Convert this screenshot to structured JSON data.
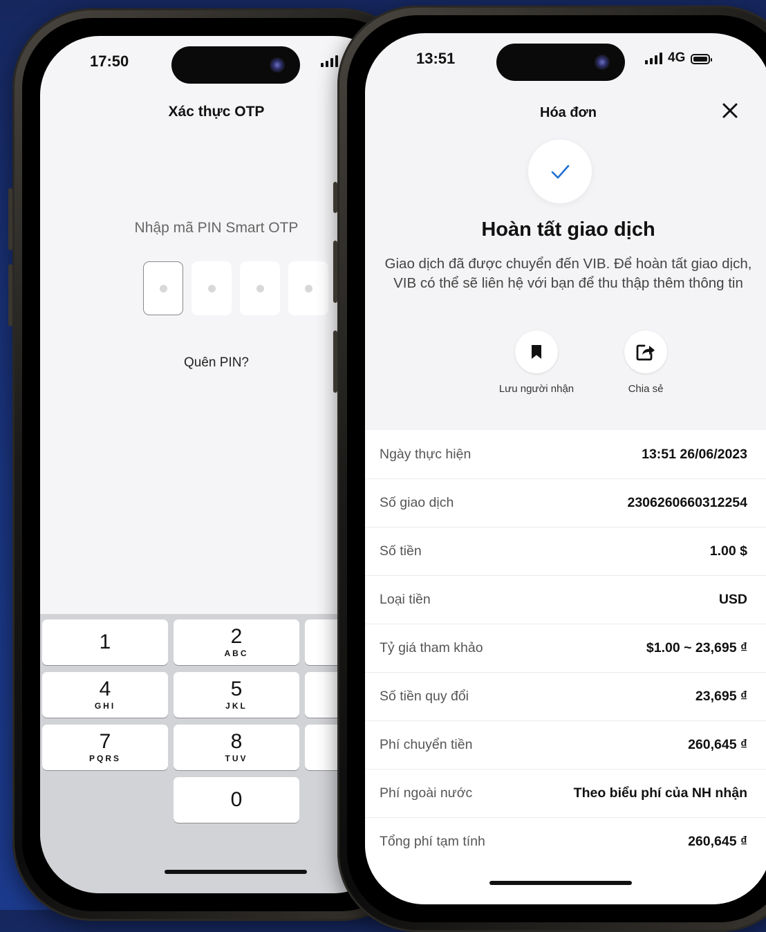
{
  "left_phone": {
    "status": {
      "time": "17:50"
    },
    "title": "Xác thực OTP",
    "pin_prompt": "Nhập mã PIN Smart OTP",
    "pin_boxes": 4,
    "forgot_pin": "Quên PIN?",
    "keypad": [
      {
        "num": "1",
        "letters": ""
      },
      {
        "num": "2",
        "letters": "ABC"
      },
      {
        "num": "4",
        "letters": "GHI"
      },
      {
        "num": "5",
        "letters": "JKL"
      },
      {
        "num": "7",
        "letters": "PQRS"
      },
      {
        "num": "8",
        "letters": "TUV"
      },
      {
        "num": "0",
        "letters": ""
      }
    ]
  },
  "right_phone": {
    "status": {
      "time": "13:51",
      "network": "4G"
    },
    "title": "Hóa đơn",
    "close_icon": "close-icon",
    "success_icon": "checkmark-icon",
    "heading": "Hoàn tất giao dịch",
    "description": "Giao dịch đã được chuyển đến VIB. Để hoàn tất giao dịch, VIB có thể sẽ liên hệ với bạn để thu thập thêm thông tin",
    "actions": [
      {
        "label": "Lưu người nhận",
        "icon": "bookmark-icon"
      },
      {
        "label": "Chia sẻ",
        "icon": "share-icon"
      }
    ],
    "details": [
      {
        "label": "Ngày thực hiện",
        "value": "13:51 26/06/2023"
      },
      {
        "label": "Số giao dịch",
        "value": "2306260660312254"
      },
      {
        "label": "Số tiền",
        "value": "1.00 $"
      },
      {
        "label": "Loại tiền",
        "value": "USD"
      },
      {
        "label": "Tỷ giá tham khảo",
        "value": "$1.00 ~ 23,695 ₫"
      },
      {
        "label": "Số tiền quy đổi",
        "value": "23,695 ₫"
      },
      {
        "label": "Phí chuyển tiền",
        "value": "260,645 ₫"
      },
      {
        "label": "Phí ngoài nước",
        "value": "Theo biểu phí của NH nhận"
      },
      {
        "label": "Tổng phí tạm tính",
        "value": "260,645 ₫"
      }
    ],
    "accent_color": "#1f6fd1"
  },
  "background_color": "#1a3580"
}
